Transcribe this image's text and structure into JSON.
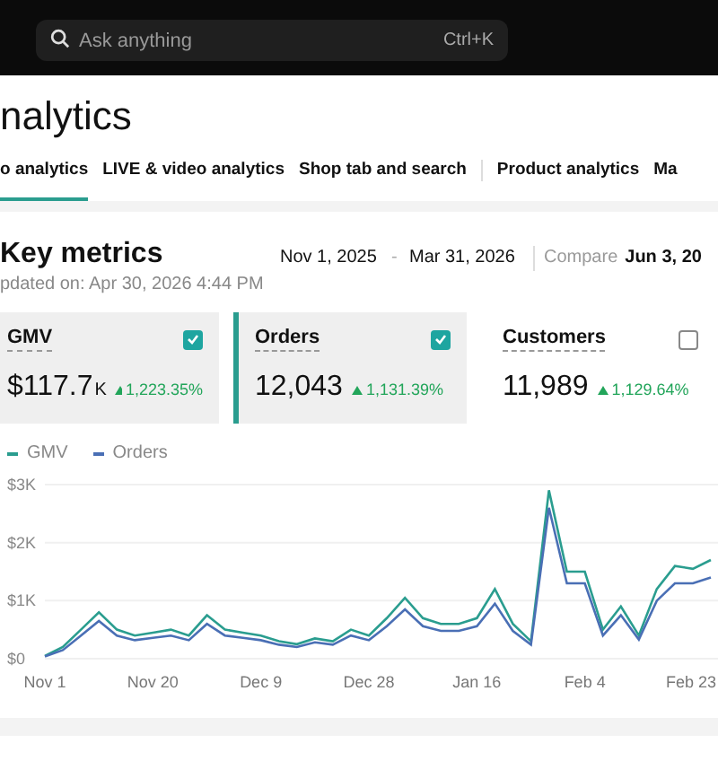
{
  "search": {
    "placeholder": "Ask anything",
    "shortcut": "Ctrl+K"
  },
  "page_title": "nalytics",
  "tabs": [
    {
      "label": "o analytics",
      "selected": true,
      "divider_after": false
    },
    {
      "label": "LIVE & video analytics",
      "selected": false,
      "divider_after": false
    },
    {
      "label": "Shop tab and search",
      "selected": false,
      "divider_after": true
    },
    {
      "label": "Product analytics",
      "selected": false,
      "divider_after": false
    },
    {
      "label": "Ma",
      "selected": false,
      "divider_after": false
    }
  ],
  "key_metrics": {
    "title": "Key metrics",
    "updated": "pdated on: Apr 30, 2026 4:44 PM",
    "date_start": "Nov 1, 2025",
    "date_sep": "-",
    "date_end": "Mar 31, 2026",
    "compare_label": "Compare",
    "compare_start": "Jun 3, 20"
  },
  "metrics": [
    {
      "label": "GMV",
      "value": "$117.7",
      "unit": "K",
      "change": "1,223.35%",
      "checked": true,
      "highlighted": false
    },
    {
      "label": "Orders",
      "value": "12,043",
      "change": "1,131.39%",
      "checked": true,
      "highlighted": true
    },
    {
      "label": "Customers",
      "value": "11,989",
      "change": "1,129.64%",
      "checked": false,
      "highlighted": false
    }
  ],
  "chart_data": {
    "type": "line",
    "categories": [
      "Nov 1",
      null,
      null,
      null,
      null,
      null,
      "Nov 20",
      null,
      null,
      null,
      null,
      null,
      "Dec 9",
      null,
      null,
      null,
      null,
      null,
      "Dec 28",
      null,
      null,
      null,
      null,
      null,
      "Jan 16",
      null,
      null,
      null,
      null,
      null,
      "Feb 4",
      null,
      null,
      null,
      null,
      null,
      "Feb 23",
      null
    ],
    "series": [
      {
        "name": "GMV",
        "color": "#2a9d8f",
        "values": [
          50,
          200,
          500,
          800,
          500,
          400,
          450,
          500,
          400,
          750,
          500,
          450,
          400,
          300,
          250,
          350,
          300,
          500,
          400,
          700,
          1050,
          700,
          600,
          600,
          700,
          1200,
          600,
          300,
          2900,
          1500,
          1500,
          500,
          900,
          400,
          1200,
          1600,
          1550,
          1700
        ]
      },
      {
        "name": "Orders",
        "color": "#4a6fb5",
        "values": [
          40,
          150,
          400,
          650,
          400,
          320,
          360,
          400,
          320,
          600,
          400,
          360,
          320,
          240,
          200,
          280,
          240,
          400,
          320,
          560,
          850,
          560,
          480,
          480,
          560,
          950,
          480,
          240,
          2600,
          1300,
          1300,
          400,
          750,
          330,
          1000,
          1300,
          1300,
          1400
        ]
      }
    ],
    "ylim": [
      0,
      3000
    ],
    "yticks": [
      {
        "value": 0,
        "label": "$0"
      },
      {
        "value": 1000,
        "label": "$1K"
      },
      {
        "value": 2000,
        "label": "$2K"
      },
      {
        "value": 3000,
        "label": "$3K"
      }
    ]
  }
}
